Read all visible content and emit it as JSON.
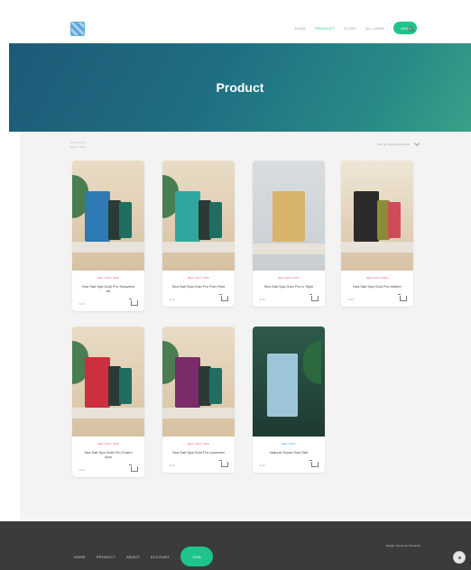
{
  "header": {
    "nav": [
      {
        "label": "HOME",
        "active": false
      },
      {
        "label": "PRODUCT",
        "active": true
      },
      {
        "label": "STORY",
        "active": false
      },
      {
        "label": "ALL USER",
        "active": false
      }
    ],
    "cta": "SIGN"
  },
  "hero": {
    "title": "Product"
  },
  "panel": {
    "breadcrumb": [
      "PRODUCT",
      "SALT SPA"
    ],
    "sort_label": "Sort by: latest products (A)"
  },
  "products": [
    {
      "category": "SEA SALT SPA",
      "name": "Sea Salt Spa Gold Pro Seaweed kit",
      "price": "$ 10",
      "color": "#2f79b5"
    },
    {
      "category": "SEA SALT SPA",
      "name": "Sea Salt Spa Gold Pro Fish Fillet",
      "price": "$ 10",
      "color": "#2fa7a0"
    },
    {
      "category": "SEA SALT SPA",
      "name": "Sea Salt Spa Gold Pro Li Style",
      "price": "$ 10",
      "color": "#d7b46a"
    },
    {
      "category": "SEA SALT SPA",
      "name": "Sea Salt Spa Gold Pro Mother",
      "price": "$ 10",
      "color": "#2b2b2b"
    },
    {
      "category": "SEA SALT SPA",
      "name": "Sea Salt Spa Gold Pro Charm Aloe",
      "price": "$ 10",
      "color": "#cc2f3d"
    },
    {
      "category": "SEA SALT SPA",
      "name": "Sea Salt Spa Gold Pro Lavender",
      "price": "$ 10",
      "color": "#7b2a6a"
    },
    {
      "category": "SEA SALT",
      "name": "Natural Ocean Sea Salt",
      "price": "$ 10",
      "color": "#2d6a9e"
    }
  ],
  "footer": {
    "nav": [
      "HOME",
      "PRODUCT",
      "ABOUT",
      "ACCOUNT"
    ],
    "cta": "JOIN",
    "right_text": "Design: Theme by Themeinc"
  }
}
